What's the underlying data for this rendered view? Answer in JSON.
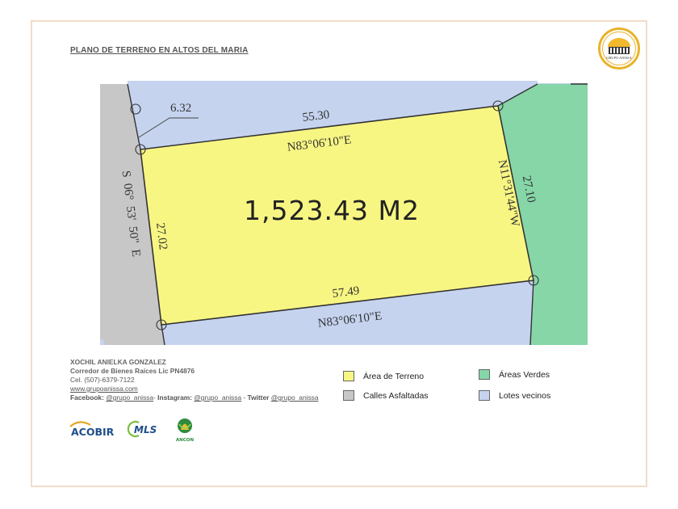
{
  "header": {
    "title": "PLANO DE TERRENO EN ALTOS DEL MARIA",
    "logo_text": "GRUPO ANISSA"
  },
  "plan": {
    "area_label": "1,523.43 M2",
    "top_length": "55.30",
    "top_bearing": "N83°06'10\"E",
    "bottom_length": "57.49",
    "bottom_bearing": "N83°06'10\"E",
    "left_length": "27.02",
    "left_bearing": "S  06°  53'  50\"  E",
    "right_length": "27.10",
    "right_bearing": "N11°31'44\"W",
    "corner_offset": "6.32",
    "colors": {
      "terreno": "#f8f683",
      "calles": "#c7c7c7",
      "verdes": "#86d6a8",
      "vecinos": "#c5d3ef"
    }
  },
  "contact": {
    "name": "XOCHIL ANIELKA GONZALEZ",
    "role": "Corredor de Bienes Raíces Lic PN4876",
    "phone": "Cel. (507)-6379-7122",
    "website": "www.grupoanissa.com",
    "facebook_label": "Facebook:",
    "facebook_handle": "@grupo_anissa",
    "instagram_label": "Instagram:",
    "instagram_handle": "@grupo_anissa",
    "twitter_label": "Twitter",
    "twitter_handle": "@grupo_anissa"
  },
  "legend": [
    {
      "label": "Área de Terreno",
      "color": "#f8f683"
    },
    {
      "label": "Calles Asfaltadas",
      "color": "#c7c7c7"
    },
    {
      "label": "Áreas Verdes",
      "color": "#86d6a8"
    },
    {
      "label": "Lotes vecinos",
      "color": "#c5d3ef"
    }
  ],
  "brands": {
    "acobir": "ACOBIR",
    "mls": "MLS",
    "ancon": "ANCON"
  }
}
